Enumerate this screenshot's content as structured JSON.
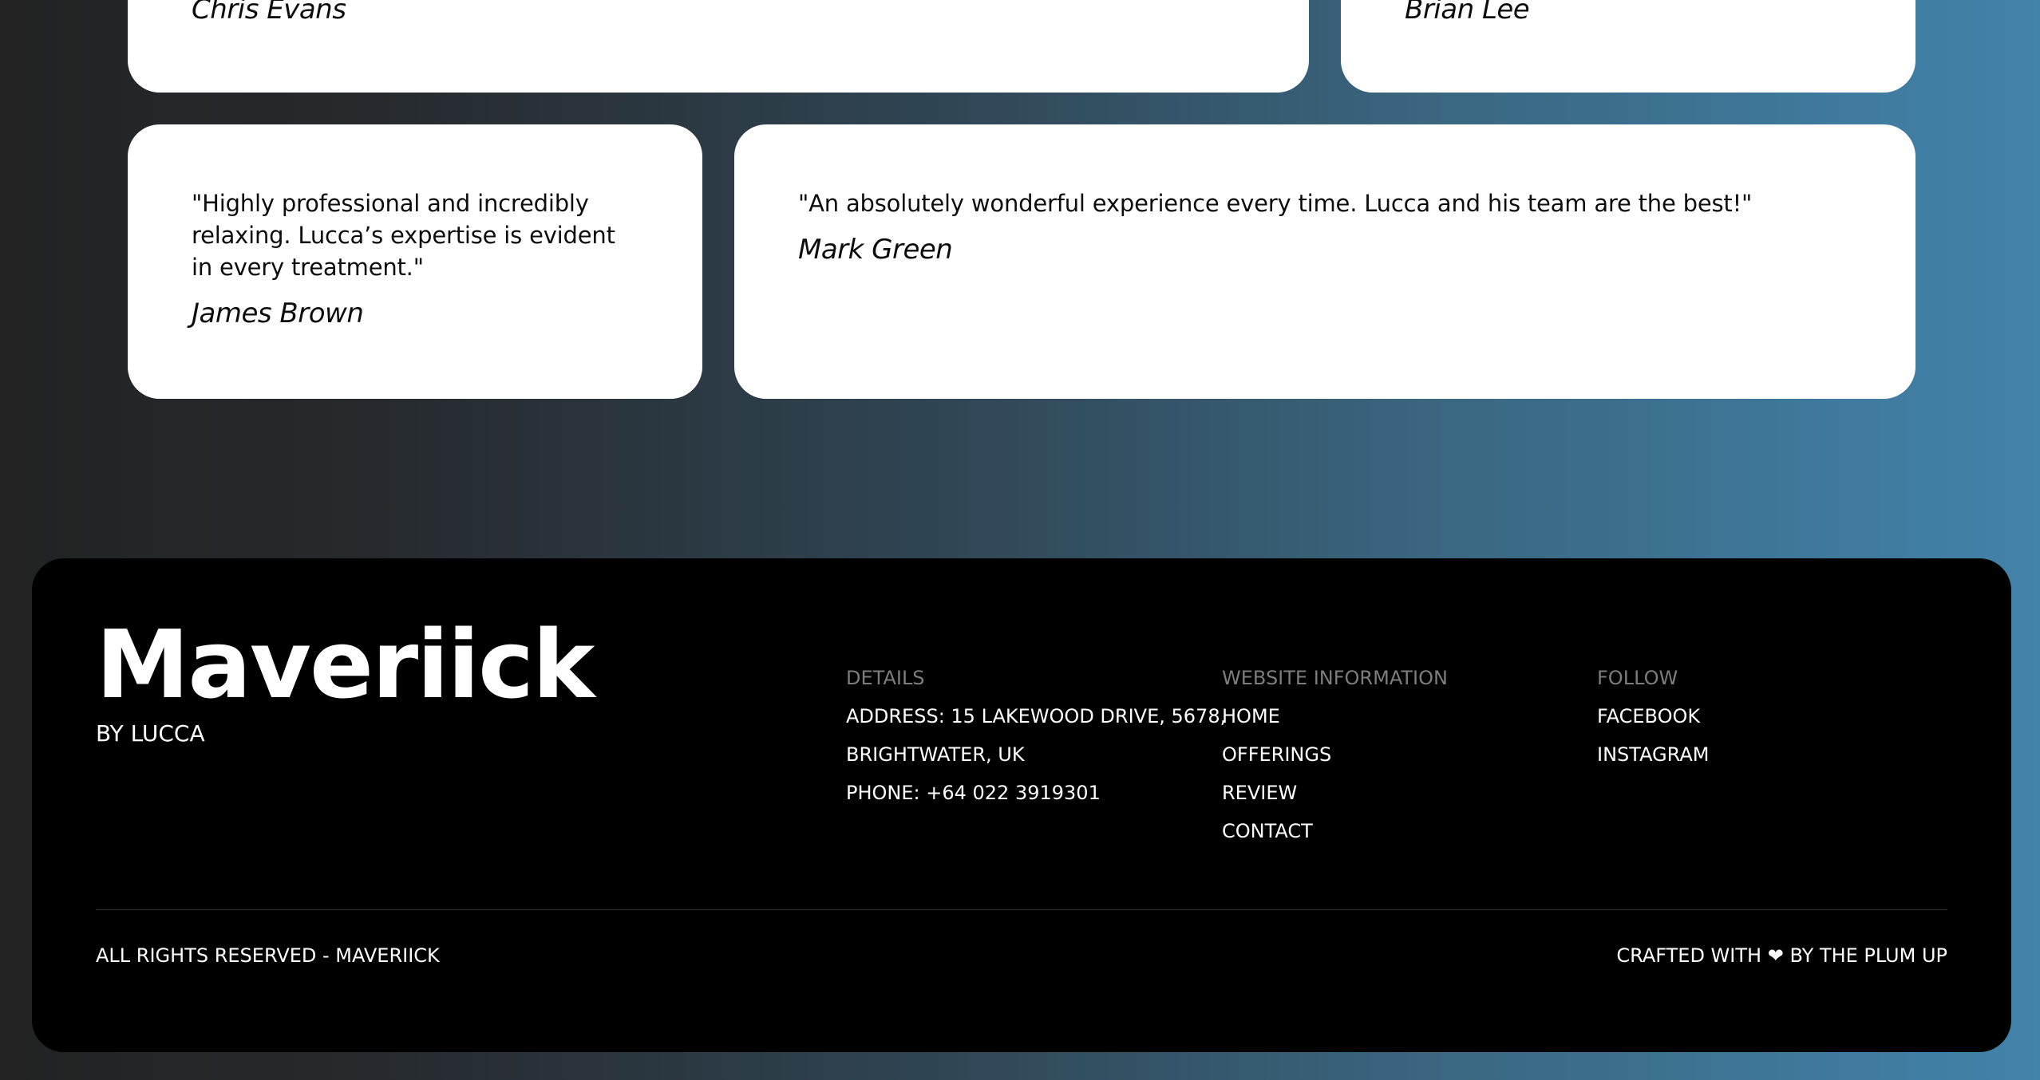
{
  "testimonials": [
    {
      "quote": "",
      "author": "Chris Evans"
    },
    {
      "quote": "",
      "author": "Brian Lee"
    },
    {
      "quote": "\"Highly professional and incredibly relaxing. Lucca’s expertise is evident in every treatment.\"",
      "author": "James Brown"
    },
    {
      "quote": "\"An absolutely wonderful experience every time. Lucca and his team are the best!\"",
      "author": "Mark Green"
    }
  ],
  "footer": {
    "brand": "Maveriick",
    "byline": "BY LUCCA",
    "details": {
      "heading": "DETAILS",
      "address_line1": "ADDRESS: 15 LAKEWOOD DRIVE, 5678,",
      "address_line2": "BRIGHTWATER, UK",
      "phone": "PHONE: +64 022 3919301"
    },
    "website": {
      "heading": "WEBSITE INFORMATION",
      "links": [
        "HOME",
        "OFFERINGS",
        "REVIEW",
        "CONTACT"
      ]
    },
    "follow": {
      "heading": "FOLLOW",
      "links": [
        "FACEBOOK",
        "INSTAGRAM"
      ]
    },
    "copyright": "ALL RIGHTS RESERVED - MAVERIICK",
    "crafted_prefix": "CRAFTED WITH",
    "crafted_heart": "❤",
    "crafted_suffix": "BY THE PLUM UP"
  },
  "colors": {
    "card_background": "#ffffff",
    "footer_background": "#000000",
    "muted_heading": "#7d7d7d",
    "gradient_start": "#222222",
    "gradient_end": "#4283aa"
  }
}
